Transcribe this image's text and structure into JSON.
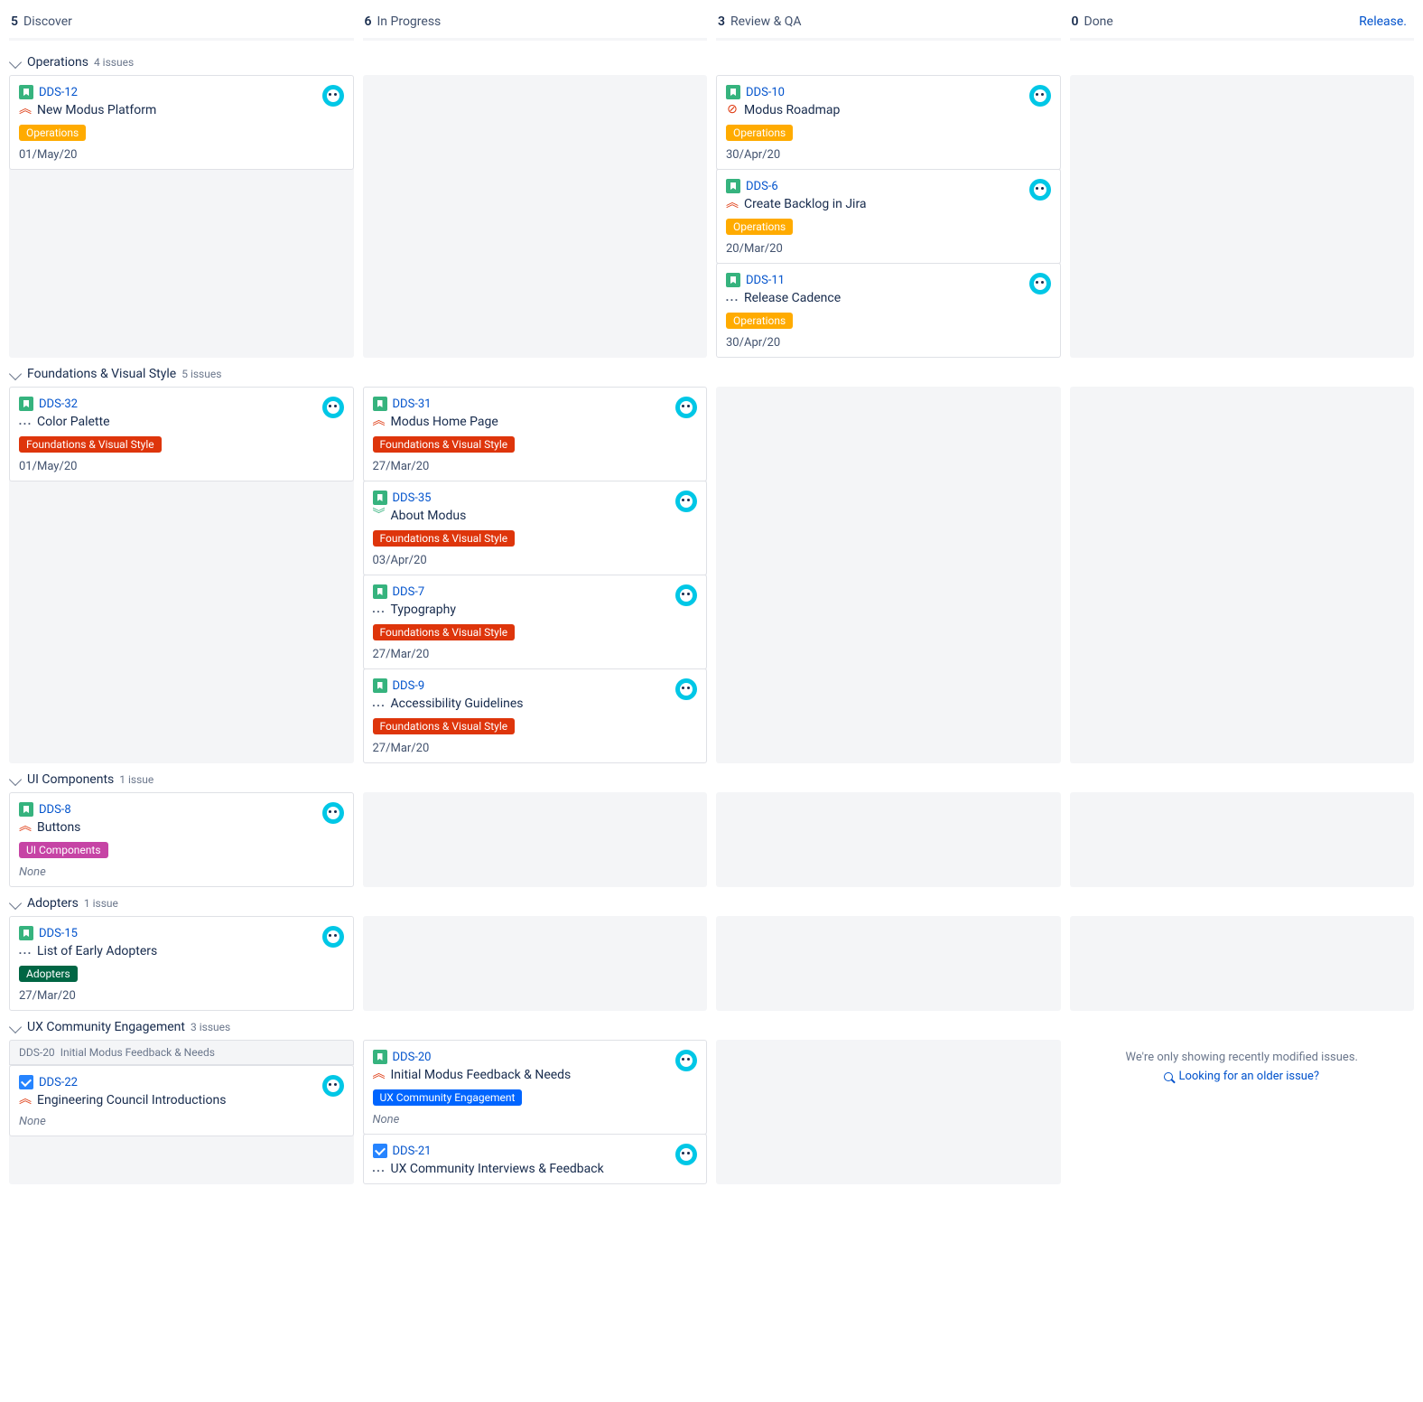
{
  "columns": [
    {
      "count": "5",
      "label": "Discover"
    },
    {
      "count": "6",
      "label": "In Progress"
    },
    {
      "count": "3",
      "label": "Review & QA"
    },
    {
      "count": "0",
      "label": "Done",
      "release": "Release."
    }
  ],
  "swimlanes": {
    "operations": {
      "name": "Operations",
      "subcount": "4 issues",
      "cells": {
        "discover": [
          {
            "key": "DDS-12",
            "title": "New Modus Platform",
            "tag": "Operations",
            "tagColor": "#ffab00",
            "date": "01/May/20",
            "type": "story",
            "prio": "highest"
          }
        ],
        "review": [
          {
            "key": "DDS-10",
            "title": "Modus Roadmap",
            "tag": "Operations",
            "tagColor": "#ffab00",
            "date": "30/Apr/20",
            "type": "story",
            "prio": "block"
          },
          {
            "key": "DDS-6",
            "title": "Create Backlog in Jira",
            "tag": "Operations",
            "tagColor": "#ffab00",
            "date": "20/Mar/20",
            "type": "story",
            "prio": "highest"
          },
          {
            "key": "DDS-11",
            "title": "Release Cadence",
            "tag": "Operations",
            "tagColor": "#ffab00",
            "date": "30/Apr/20",
            "type": "story",
            "prio": "ellipsis"
          }
        ]
      }
    },
    "foundations": {
      "name": "Foundations & Visual Style",
      "subcount": "5 issues",
      "cells": {
        "discover": [
          {
            "key": "DDS-32",
            "title": "Color Palette",
            "tag": "Foundations & Visual Style",
            "tagColor": "#de350b",
            "date": "01/May/20",
            "type": "story",
            "prio": "ellipsis"
          }
        ],
        "progress": [
          {
            "key": "DDS-31",
            "title": "Modus Home Page",
            "tag": "Foundations & Visual Style",
            "tagColor": "#de350b",
            "date": "27/Mar/20",
            "type": "story",
            "prio": "highest"
          },
          {
            "key": "DDS-35",
            "title": "About Modus",
            "tag": "Foundations & Visual Style",
            "tagColor": "#de350b",
            "date": "03/Apr/20",
            "type": "story",
            "prio": "low"
          },
          {
            "key": "DDS-7",
            "title": "Typography",
            "tag": "Foundations & Visual Style",
            "tagColor": "#de350b",
            "date": "27/Mar/20",
            "type": "story",
            "prio": "ellipsis"
          },
          {
            "key": "DDS-9",
            "title": "Accessibility Guidelines",
            "tag": "Foundations & Visual Style",
            "tagColor": "#de350b",
            "date": "27/Mar/20",
            "type": "story",
            "prio": "ellipsis"
          }
        ]
      }
    },
    "ui": {
      "name": "UI Components",
      "subcount": "1 issue",
      "cells": {
        "discover": [
          {
            "key": "DDS-8",
            "title": "Buttons",
            "tag": "UI Components",
            "tagColor": "#c644a5",
            "date": "None",
            "type": "story",
            "prio": "highest",
            "dateNone": true
          }
        ]
      }
    },
    "adopters": {
      "name": "Adopters",
      "subcount": "1 issue",
      "cells": {
        "discover": [
          {
            "key": "DDS-15",
            "title": "List of Early Adopters",
            "tag": "Adopters",
            "tagColor": "#006644",
            "date": "27/Mar/20",
            "type": "story",
            "prio": "ellipsis"
          }
        ]
      }
    },
    "ux": {
      "name": "UX Community Engagement",
      "subcount": "3 issues",
      "subHeader": {
        "key": "DDS-20",
        "title": "Initial Modus Feedback & Needs"
      },
      "cells": {
        "discover": [
          {
            "key": "DDS-22",
            "title": "Engineering Council Introductions",
            "date": "None",
            "type": "task",
            "prio": "highest",
            "dateNone": true,
            "noTag": true
          }
        ],
        "progress": [
          {
            "key": "DDS-20",
            "title": "Initial Modus Feedback & Needs",
            "tag": "UX Community Engagement",
            "tagColor": "#0065ff",
            "date": "None",
            "type": "story",
            "prio": "highest",
            "dateNone": true
          },
          {
            "key": "DDS-21",
            "title": "UX Community Interviews & Feedback",
            "type": "task",
            "prio": "ellipsis",
            "noTag": true,
            "noDate": true
          }
        ]
      },
      "doneNote": "We're only showing recently modified issues.",
      "doneLink": "Looking for an older issue?"
    }
  }
}
